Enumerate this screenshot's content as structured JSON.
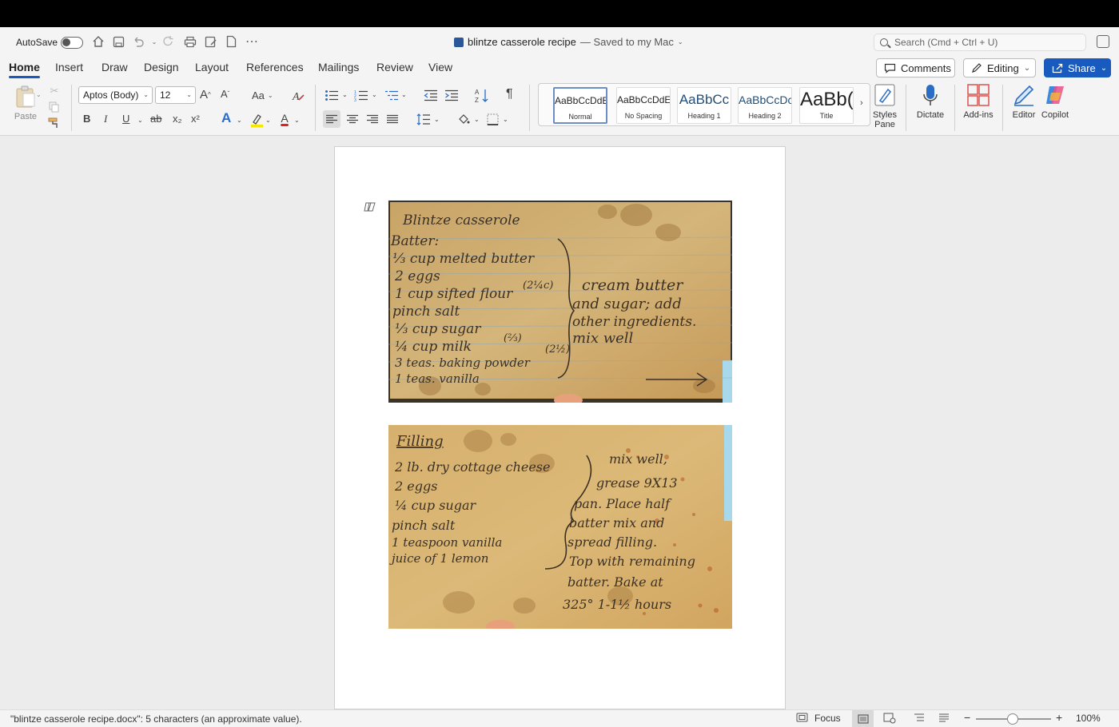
{
  "titlebar": {
    "autosave_label": "AutoSave",
    "document_name": "blintze casserole recipe",
    "saved_status": "— Saved to my Mac",
    "search_placeholder": "Search (Cmd + Ctrl + U)"
  },
  "tabs": [
    {
      "label": "Home",
      "active": true
    },
    {
      "label": "Insert"
    },
    {
      "label": "Draw"
    },
    {
      "label": "Design"
    },
    {
      "label": "Layout"
    },
    {
      "label": "References"
    },
    {
      "label": "Mailings"
    },
    {
      "label": "Review"
    },
    {
      "label": "View"
    }
  ],
  "actions": {
    "comments": "Comments",
    "editing": "Editing",
    "share": "Share"
  },
  "ribbon": {
    "paste_label": "Paste",
    "font_name": "Aptos (Body)",
    "font_size": "12",
    "change_case": "Aa",
    "styles": [
      {
        "sample": "AaBbCcDdE",
        "name": "Normal",
        "selected": true
      },
      {
        "sample": "AaBbCcDdE",
        "name": "No Spacing"
      },
      {
        "sample": "AaBbCc",
        "name": "Heading 1"
      },
      {
        "sample": "AaBbCcDc",
        "name": "Heading 2"
      },
      {
        "sample": "AaBb(",
        "name": "Title"
      }
    ],
    "styles_pane": "Styles Pane",
    "dictate": "Dictate",
    "addins": "Add-ins",
    "editor": "Editor",
    "copilot": "Copilot",
    "format_buttons": {
      "bold": "B",
      "italic": "I",
      "underline": "U",
      "strike": "ab",
      "subscript": "x₂",
      "superscript": "x²",
      "text_effect": "A",
      "font_color": "A"
    },
    "colors": {
      "highlight": "#f5e700",
      "font_color": "#e02020",
      "accent": "#185abd"
    }
  },
  "recipe_card_1": {
    "title": "Blintze casserole",
    "batter_label": "Batter:",
    "ingredients": [
      "⅓ cup melted butter",
      "2 eggs",
      "1 cup sifted flour",
      "pinch salt",
      "⅓ cup sugar",
      "¼ cup milk",
      "3 teas. baking powder",
      "1 teas. vanilla"
    ],
    "notes_x": [
      "(2¼c)",
      "(⅔)",
      "(2½)"
    ],
    "instructions": [
      "cream butter",
      "and sugar; add",
      "other ingredients.",
      "mix well"
    ]
  },
  "recipe_card_2": {
    "title": "Filling",
    "ingredients": [
      "2 lb. dry cottage cheese",
      "2 eggs",
      "¼ cup sugar",
      "pinch salt",
      "1 teaspoon vanilla",
      "juice of 1 lemon"
    ],
    "instructions": [
      "mix well,",
      "grease 9X13",
      "pan. Place half",
      "batter mix and",
      "spread filling.",
      "Top with remaining",
      "batter. Bake at",
      "325° 1-1½ hours"
    ]
  },
  "statusbar": {
    "word_count": "\"blintze casserole recipe.docx\": 5 characters (an approximate value).",
    "focus": "Focus",
    "zoom": "100%"
  }
}
